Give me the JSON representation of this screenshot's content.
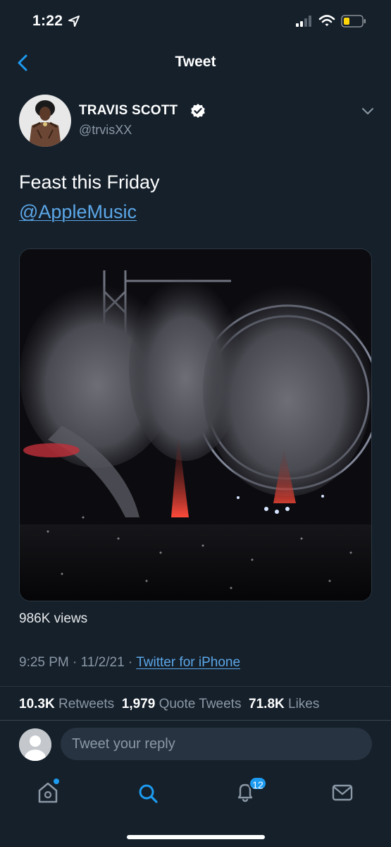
{
  "status_bar": {
    "time": "1:22"
  },
  "nav": {
    "title": "Tweet"
  },
  "author": {
    "name": "TRAVIS SCOTT",
    "handle": "@trvisXX"
  },
  "tweet": {
    "text": "Feast this Friday",
    "mention": "@AppleMusic",
    "views": "986K views",
    "time": "9:25 PM",
    "date": "11/2/21",
    "separator": "·",
    "source": "Twitter for iPhone"
  },
  "stats": {
    "retweets_count": "10.3K",
    "retweets_label": "Retweets",
    "quotes_count": "1,979",
    "quotes_label": "Quote Tweets",
    "likes_count": "71.8K",
    "likes_label": "Likes"
  },
  "reply": {
    "placeholder": "Tweet your reply"
  },
  "tab_bar": {
    "items": [
      {
        "icon": "home-icon"
      },
      {
        "icon": "search-icon"
      },
      {
        "icon": "notifications-icon"
      },
      {
        "icon": "messages-icon"
      }
    ],
    "notifications_badge": "12"
  },
  "colors": {
    "background": "#15202b",
    "link": "#5ca7e8",
    "accent": "#1d9bf0",
    "secondary_text": "#8b98a5"
  }
}
